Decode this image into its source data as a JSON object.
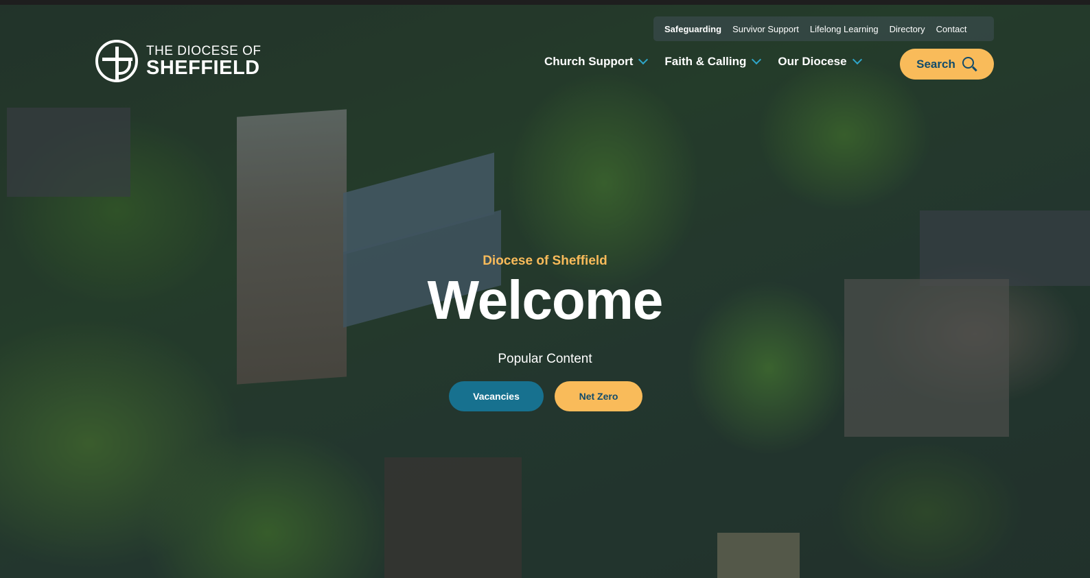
{
  "logo": {
    "line1": "THE DIOCESE OF",
    "line2": "SHEFFIELD",
    "icon": "cross-in-circle-icon"
  },
  "utility_nav": {
    "items": [
      {
        "label": "Safeguarding",
        "bold": true
      },
      {
        "label": "Survivor Support"
      },
      {
        "label": "Lifelong Learning"
      },
      {
        "label": "Directory"
      },
      {
        "label": "Contact"
      }
    ]
  },
  "main_nav": {
    "items": [
      {
        "label": "Church Support",
        "icon": "chevron-down-icon"
      },
      {
        "label": "Faith & Calling",
        "icon": "chevron-down-icon"
      },
      {
        "label": "Our Diocese",
        "icon": "chevron-down-icon"
      }
    ],
    "search_label": "Search",
    "search_icon": "search-icon"
  },
  "hero": {
    "eyebrow": "Diocese of Sheffield",
    "title": "Welcome",
    "popular_label": "Popular Content",
    "buttons": [
      {
        "label": "Vacancies"
      },
      {
        "label": "Net Zero"
      }
    ]
  },
  "colors": {
    "accent_yellow": "#f9bb5a",
    "teal": "#17718f",
    "navy_text": "#114b6b",
    "chevron_blue": "#2fa6c9"
  }
}
